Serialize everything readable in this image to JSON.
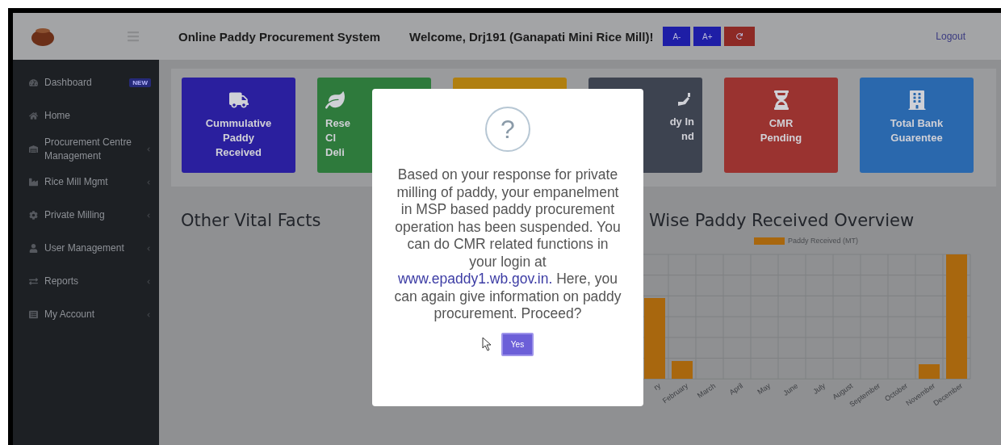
{
  "header": {
    "title": "Online Paddy Procurement System",
    "welcome": "Welcome, Drj191 (Ganapati Mini Rice Mill)!",
    "font_buttons": [
      {
        "label": "A-",
        "kind": "text"
      },
      {
        "label": "A+",
        "kind": "text"
      },
      {
        "kind": "reset"
      }
    ],
    "logout": "Logout"
  },
  "sidebar": {
    "items": [
      {
        "label": "Dashboard",
        "badge": "NEW",
        "has_submenu": false
      },
      {
        "label": "Home",
        "has_submenu": false
      },
      {
        "label": "Procurement Centre Management",
        "has_submenu": true
      },
      {
        "label": "Rice Mill Mgmt",
        "has_submenu": true
      },
      {
        "label": "Private Milling",
        "has_submenu": true
      },
      {
        "label": "User Management",
        "has_submenu": true
      },
      {
        "label": "Reports",
        "has_submenu": true
      },
      {
        "label": "My Account",
        "has_submenu": true
      }
    ]
  },
  "cards": [
    {
      "lines": [
        "Cummulative",
        "Paddy",
        "Received"
      ],
      "color": "#2a1f9e",
      "kind": "whole"
    },
    {
      "lines": [
        "Rese",
        "Cl",
        "Deli"
      ],
      "color": "#2e7a3c",
      "kind": "cut_right"
    },
    {
      "color": "#b07f10",
      "kind": "hidden"
    },
    {
      "lines": [
        "dy In",
        "nd"
      ],
      "color": "#3d4350",
      "kind": "cut_left"
    },
    {
      "lines": [
        "CMR",
        "Pending"
      ],
      "color": "#9a3330",
      "kind": "whole"
    },
    {
      "lines": [
        "Total Bank",
        "Guarentee"
      ],
      "color": "#2a68ad",
      "kind": "whole"
    }
  ],
  "vital_facts": {
    "title": "Other Vital Facts"
  },
  "chart": {
    "title": "Wise Paddy Received Overview",
    "legend": "Paddy Received (MT)",
    "x_labels": [
      "ry",
      "February",
      "March",
      "April",
      "May",
      "June",
      "July",
      "August",
      "September",
      "October",
      "November",
      "December"
    ]
  },
  "dialog": {
    "icon_text": "?",
    "message_before": "Based on your response for private milling of paddy, your empanelment in MSP based paddy procurement operation has been suspended. You can do CMR related functions in your login at ",
    "link": "www.epaddy1.wb.gov.in.",
    "message_after": " Here, you can again give information on paddy procurement. Proceed?",
    "confirm": "Yes"
  }
}
